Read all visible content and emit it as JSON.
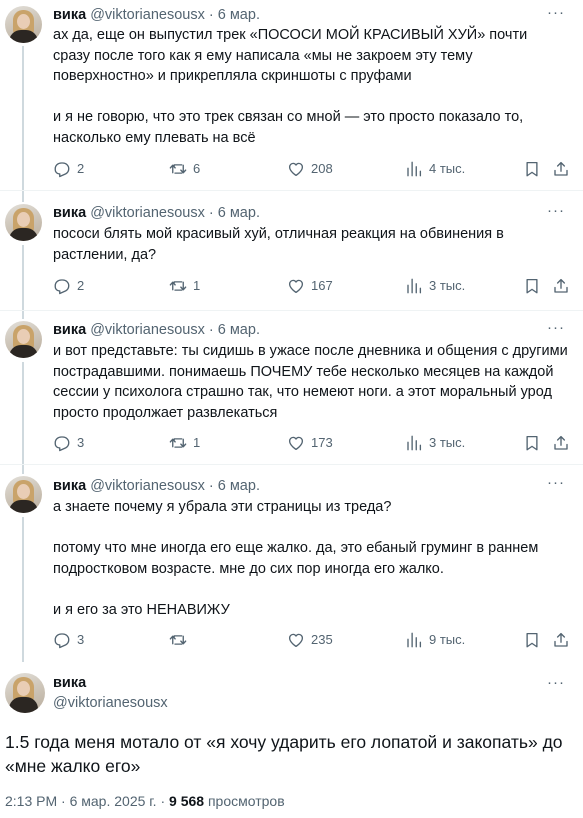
{
  "tweets": [
    {
      "name": "вика",
      "handle": "@viktorianesousx",
      "dot": "·",
      "date": "6 мар.",
      "more": "···",
      "paragraphs": [
        "ах да, еще он выпустил трек «ПОСОСИ МОЙ КРАСИВЫЙ ХУЙ» почти сразу после того как я ему написала «мы не закроем эту тему поверхностно» и прикрепляла скриншоты с пруфами",
        "и я не говорю, что это трек связан со мной — это просто показало то, насколько ему плевать на всё"
      ],
      "replies": "2",
      "retweets": "6",
      "likes": "208",
      "views": "4 тыс."
    },
    {
      "name": "вика",
      "handle": "@viktorianesousx",
      "dot": "·",
      "date": "6 мар.",
      "more": "···",
      "paragraphs": [
        "пососи блять мой красивый хуй, отличная реакция на обвинения в растлении, да?"
      ],
      "replies": "2",
      "retweets": "1",
      "likes": "167",
      "views": "3 тыс."
    },
    {
      "name": "вика",
      "handle": "@viktorianesousx",
      "dot": "·",
      "date": "6 мар.",
      "more": "···",
      "paragraphs": [
        "и вот представьте: ты сидишь в ужасе после дневника и общения с другими пострадавшими. понимаешь ПОЧЕМУ тебе несколько месяцев на каждой сессии у психолога страшно так, что немеют ноги. а этот моральный урод просто продолжает развлекаться"
      ],
      "replies": "3",
      "retweets": "1",
      "likes": "173",
      "views": "3 тыс."
    },
    {
      "name": "вика",
      "handle": "@viktorianesousx",
      "dot": "·",
      "date": "6 мар.",
      "more": "···",
      "paragraphs": [
        "а знаете почему я убрала эти страницы из треда?",
        "потому что мне иногда его еще жалко. да, это ебаный груминг в раннем подростковом возрасте. мне до сих пор иногда его жалко.",
        "и я его за это НЕНАВИЖУ"
      ],
      "replies": "3",
      "retweets": "",
      "likes": "235",
      "views": "9 тыс."
    }
  ],
  "main": {
    "name": "вика",
    "handle": "@viktorianesousx",
    "more": "···",
    "text": "1.5 года меня мотало от «я хочу ударить его лопатой и закопать» до «мне жалко его»",
    "time": "2:13 PM",
    "dot1": "·",
    "date": "6 мар. 2025 г.",
    "dot2": "·",
    "views_count": "9 568",
    "views_label": "просмотров"
  },
  "icons": {
    "reply": "reply-icon",
    "retweet": "retweet-icon",
    "like": "heart-icon",
    "views": "views-chart-icon",
    "bookmark": "bookmark-icon",
    "share": "share-icon",
    "more": "more-dots-icon"
  },
  "colors": {
    "text": "#0f1419",
    "secondary": "#536471",
    "thread_line": "#cfd9de",
    "divider": "#eff3f4"
  }
}
